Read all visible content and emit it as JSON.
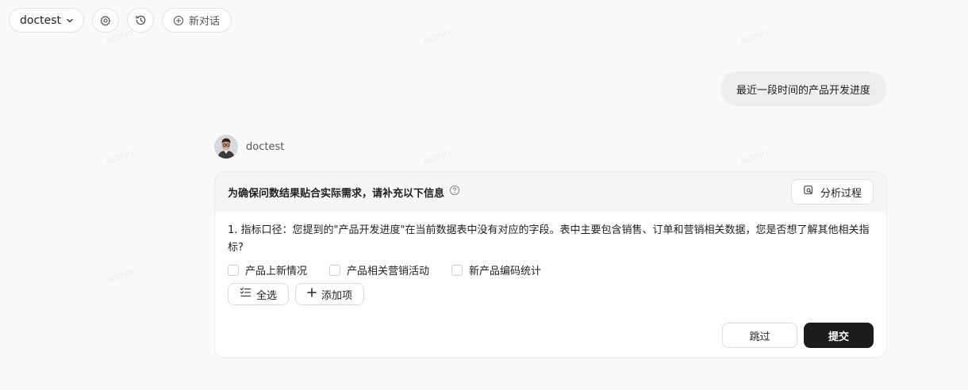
{
  "toolbar": {
    "workspace_label": "doctest",
    "new_chat_label": "新对话"
  },
  "watermark_text": "admin",
  "conversation": {
    "user_message": "最近一段时间的产品开发进度",
    "assistant_name": "doctest"
  },
  "clarify_card": {
    "title": "为确保问数结果贴合实际需求，请补充以下信息",
    "analysis_button": "分析过程",
    "question": "1. 指标口径：您提到的\"产品开发进度\"在当前数据表中没有对应的字段。表中主要包含销售、订单和营销相关数据，您是否想了解其他相关指标?",
    "options": [
      "产品上新情况",
      "产品相关营销活动",
      "新产品编码统计"
    ],
    "select_all_label": "全选",
    "add_item_label": "添加项",
    "skip_label": "跳过",
    "submit_label": "提交"
  },
  "colors": {
    "page_bg": "#fafafa",
    "submit_bg": "#1c1c1e",
    "user_bubble": "#eeeeef"
  }
}
